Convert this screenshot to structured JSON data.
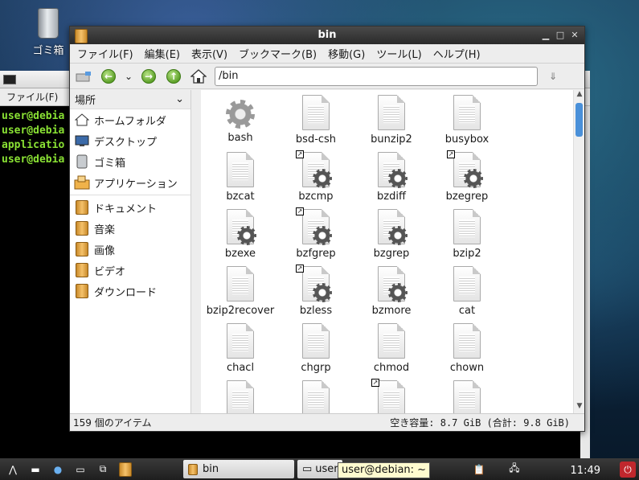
{
  "desktop": {
    "trash_label": "ゴミ箱"
  },
  "terminal": {
    "menu_label": "ファイル(F)",
    "lines": [
      "user@debia",
      "user@debia",
      "applicatio",
      "user@debia"
    ]
  },
  "window": {
    "title": "bin",
    "menu": [
      "ファイル(F)",
      "編集(E)",
      "表示(V)",
      "ブックマーク(B)",
      "移動(G)",
      "ツール(L)",
      "ヘルプ(H)"
    ],
    "location": "/bin",
    "sidebar_heading": "場所",
    "places": [
      "ホームフォルダ",
      "デスクトップ",
      "ゴミ箱",
      "アプリケーション"
    ],
    "bookmarks": [
      "ドキュメント",
      "音楽",
      "画像",
      "ビデオ",
      "ダウンロード"
    ],
    "files": [
      {
        "name": "bash",
        "icon": "gear-icon",
        "link": false
      },
      {
        "name": "bsd-csh",
        "icon": "document-icon",
        "link": false
      },
      {
        "name": "bunzip2",
        "icon": "document-icon",
        "link": false
      },
      {
        "name": "busybox",
        "icon": "document-icon",
        "link": false
      },
      {
        "name": "bzcat",
        "icon": "document-icon",
        "link": false
      },
      {
        "name": "bzcmp",
        "icon": "executable-icon",
        "link": true
      },
      {
        "name": "bzdiff",
        "icon": "executable-icon",
        "link": false
      },
      {
        "name": "bzegrep",
        "icon": "executable-icon",
        "link": true
      },
      {
        "name": "bzexe",
        "icon": "executable-icon",
        "link": false
      },
      {
        "name": "bzfgrep",
        "icon": "executable-icon",
        "link": true
      },
      {
        "name": "bzgrep",
        "icon": "executable-icon",
        "link": false
      },
      {
        "name": "bzip2",
        "icon": "document-icon",
        "link": false
      },
      {
        "name": "bzip2recover",
        "icon": "document-icon",
        "link": false
      },
      {
        "name": "bzless",
        "icon": "executable-icon",
        "link": true
      },
      {
        "name": "bzmore",
        "icon": "executable-icon",
        "link": false
      },
      {
        "name": "cat",
        "icon": "document-icon",
        "link": false
      },
      {
        "name": "chacl",
        "icon": "document-icon",
        "link": false
      },
      {
        "name": "chgrp",
        "icon": "document-icon",
        "link": false
      },
      {
        "name": "chmod",
        "icon": "document-icon",
        "link": false
      },
      {
        "name": "chown",
        "icon": "document-icon",
        "link": false
      },
      {
        "name": "",
        "icon": "document-icon",
        "link": false
      },
      {
        "name": "",
        "icon": "document-icon",
        "link": false
      },
      {
        "name": "",
        "icon": "document-icon",
        "link": true
      },
      {
        "name": "",
        "icon": "document-icon",
        "link": false
      }
    ],
    "status_count": "159 個のアイテム",
    "status_free": "空き容量: 8.7 GiB (合計: 9.8 GiB)"
  },
  "taskbar": {
    "task_fm": "bin",
    "task_term": "user@",
    "tooltip": "user@debian: ~",
    "clock": "11:49"
  }
}
